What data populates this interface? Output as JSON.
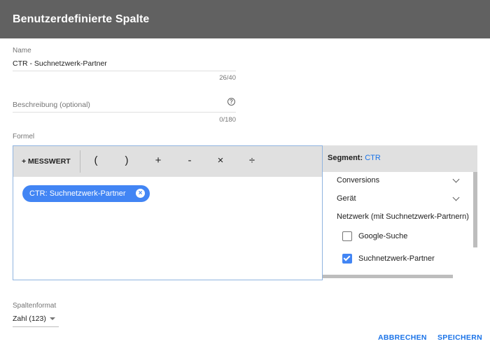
{
  "dialog": {
    "title": "Benutzerdefinierte Spalte"
  },
  "name_field": {
    "label": "Name",
    "value": "CTR - Suchnetzwerk-Partner",
    "counter": "26/40"
  },
  "description_field": {
    "placeholder": "Beschreibung (optional)",
    "counter": "0/180",
    "help_icon": "help-circle-icon"
  },
  "formula": {
    "label": "Formel",
    "toolbar": {
      "metric_button": "+ MESSWERT",
      "operators": [
        "(",
        ")",
        "+",
        "-",
        "×",
        "÷"
      ]
    },
    "chip": {
      "label": "CTR: Suchnetzwerk-Partner",
      "close_icon": "close-circle-icon"
    }
  },
  "segment": {
    "label": "Segment:",
    "value": "CTR",
    "items": [
      {
        "label": "Conversions",
        "icon": "chevron-down-icon"
      },
      {
        "label": "Gerät",
        "icon": "chevron-down-icon"
      },
      {
        "label": "Netzwerk (mit Suchnetzwerk-Partnern)"
      }
    ],
    "options": [
      {
        "label": "Google-Suche",
        "checked": false
      },
      {
        "label": "Suchnetzwerk-Partner",
        "checked": true
      }
    ]
  },
  "column_format": {
    "label": "Spaltenformat",
    "value": "Zahl (123)"
  },
  "actions": {
    "cancel": "ABBRECHEN",
    "save": "SPEICHERN"
  },
  "colors": {
    "header_bg": "#616161",
    "accent": "#4285f4",
    "link": "#1a73e8"
  }
}
